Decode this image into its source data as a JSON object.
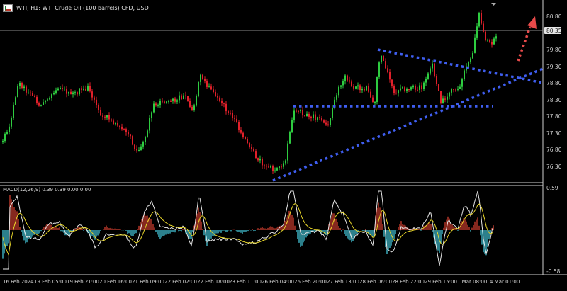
{
  "window": {
    "title": "WTI, H1:  WTI Crude Oil (100 barrels) CFD, USD"
  },
  "price_axis": {
    "labels": [
      "80.80",
      "79.80",
      "79.30",
      "78.80",
      "78.30",
      "77.80",
      "77.30",
      "76.80",
      "76.30"
    ],
    "current_price": "80.35"
  },
  "macd": {
    "label": "MACD(12,26,9) 0.39 0.39 0.00 0.00",
    "axis_labels": [
      "0.59",
      "-0.58"
    ]
  },
  "time_axis": {
    "labels": [
      "16 Feb 2024",
      "19 Feb 05:00",
      "19 Feb 21:00",
      "20 Feb 16:00",
      "21 Feb 09:00",
      "22 Feb 02:00",
      "22 Feb 18:00",
      "23 Feb 11:00",
      "26 Feb 04:00",
      "26 Feb 20:00",
      "27 Feb 13:00",
      "28 Feb 06:00",
      "28 Feb 22:00",
      "29 Feb 15:00",
      "1 Mar 08:00",
      "4 Mar 01:00"
    ]
  },
  "colors": {
    "bull": "#2ecc40",
    "bear": "#e0202a",
    "pattern_lines": "#3f5ef0",
    "forecast_arrow": "#e84a4a",
    "macd_hist_pos": "#c0392b",
    "macd_hist_neg": "#3fb7c8",
    "macd_line": "#e8e8e8",
    "signal_line": "#e8d62a"
  },
  "icons": {
    "window_icon": "chart-window-icon",
    "forecast": "dotted-up-arrow-icon"
  }
}
